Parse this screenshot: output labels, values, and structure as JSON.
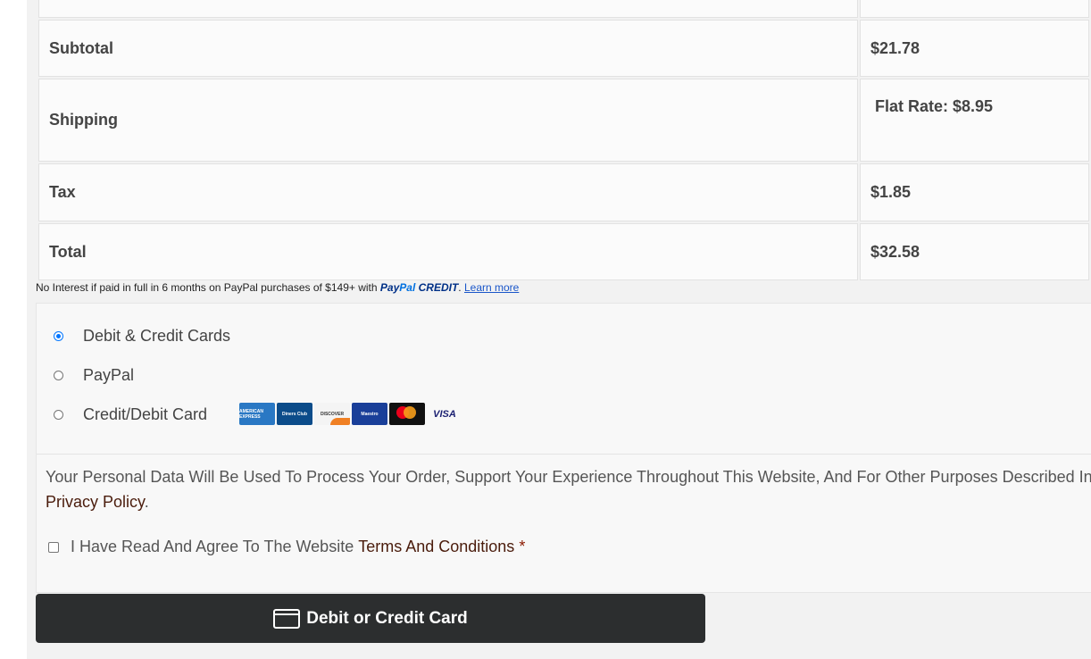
{
  "order_table": {
    "rows": [
      {
        "label": "",
        "value": ""
      },
      {
        "label": "Subtotal",
        "value": "$21.78"
      },
      {
        "label": "Shipping",
        "value": "Flat Rate: $8.95"
      },
      {
        "label": "Tax",
        "value": "$1.85"
      },
      {
        "label": "Total",
        "value": "$32.58"
      }
    ]
  },
  "paypal_credit": {
    "text": "No Interest if paid in full in 6 months on PayPal purchases of $149+ with",
    "brand_pay": "Pay",
    "brand_pal": "Pal",
    "brand_credit": "CREDIT",
    "period": ".",
    "learn_more": "Learn more"
  },
  "payment_methods": [
    {
      "label": "Debit & Credit Cards",
      "selected": true
    },
    {
      "label": "PayPal",
      "selected": false
    },
    {
      "label": "Credit/Debit Card",
      "selected": false
    }
  ],
  "card_logos": [
    {
      "name": "amex",
      "text": "AMERICAN EXPRESS"
    },
    {
      "name": "diners",
      "text": "Diners Club"
    },
    {
      "name": "discover",
      "text": "DISCOVER"
    },
    {
      "name": "maestro",
      "text": "Maestro"
    },
    {
      "name": "mastercard",
      "text": "mastercard"
    },
    {
      "name": "visa",
      "text": "VISA"
    }
  ],
  "privacy": {
    "text": "Your Personal Data Will Be Used To Process Your Order, Support Your Experience Throughout This Website, And For Other Purposes Described In Our",
    "link": "Privacy Policy",
    "period": "."
  },
  "terms": {
    "text": "I Have Read And Agree To The Website",
    "link": "Terms And Conditions",
    "required": "*"
  },
  "card_button": {
    "label": "Debit or Credit Card"
  },
  "colors": {
    "button_bg": "#2c2e2f",
    "link_dark": "#4a1c0c",
    "radio_selected": "#0075ff"
  }
}
